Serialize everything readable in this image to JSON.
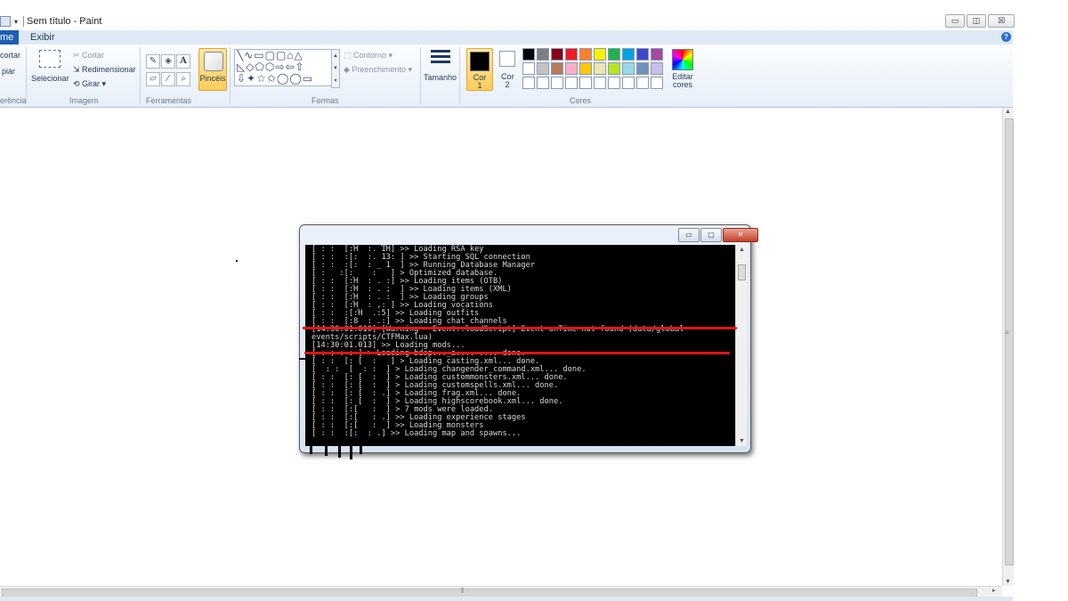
{
  "window": {
    "title": "Sem título - Paint",
    "buttons": {
      "minimize": "▭",
      "maximize": "◫",
      "close": "☒"
    }
  },
  "tabs": {
    "home": "me",
    "view": "Exibir"
  },
  "ribbon": {
    "clipboard": {
      "cut_partial": "cortar",
      "copy_partial": "piar",
      "label_partial": "erência"
    },
    "image": {
      "select": "Selecionar",
      "crop": "Cortar",
      "resize": "Redimensionar",
      "rotate": "Girar ▾",
      "label": "Imagem"
    },
    "tools": {
      "label": "Ferramentas",
      "text_tool": "A"
    },
    "brushes": {
      "label": "Pincéis"
    },
    "shapes": {
      "outline": "Contorno ▾",
      "fill": "Preenchimento ▾",
      "label": "Formas"
    },
    "size": {
      "label": "Tamanho"
    },
    "colors": {
      "color1": "Cor 1",
      "color2": "Cor 2",
      "edit": "Editar cores",
      "label": "Cores"
    }
  },
  "palette": [
    "#000000",
    "#7f7f7f",
    "#880015",
    "#ed1c24",
    "#ff7f27",
    "#fff200",
    "#22b14c",
    "#00a2e8",
    "#3f48cc",
    "#a349a4",
    "#ffffff",
    "#c3c3c3",
    "#b97a57",
    "#ffaec9",
    "#ffc90e",
    "#efe4b0",
    "#b5e61d",
    "#99d9ea",
    "#7092be",
    "#c8bfe7",
    "#ffffff",
    "#ffffff",
    "#ffffff",
    "#ffffff",
    "#ffffff",
    "#ffffff",
    "#ffffff",
    "#ffffff",
    "#ffffff",
    "#ffffff"
  ],
  "console": {
    "lines": [
      "[ : :  [:Ή  :. ΊΉ] >> Loading RSA key",
      "[ : :  :[:  :. 13: ] >> Starting SQL connection",
      "[ : :  :[:  : _ 1  ] >> Running Database Manager",
      "[ :   :[:    :   ] > Optimized database.",
      "[ : :  [:Ή  : . :] >> Loading items (OTB)",
      "[ : :  [:Ή  : . ;  ] >> Loading items (XML)",
      "[ : :  [:Ή  : . :  ] >> Loading groups",
      "[ : :  [:Ή  : ,: ] >> Loading vocations",
      "[ : :  :[:Ή  .:5] >> Loading outfits",
      "[ : :  [:8  : .:] >> Loading chat channels",
      "[14:30:01.010] [Warning - Event::loadScript] Event onTime not found (data/global",
      "events/scripts/CTFMax.lua)",
      "[14:30:01.013] >> Loading mods...",
      "[ : ; : : ] > Loading bdsp..._a.... .... done.",
      "[ : :  [: [  :   ] > Loading casting.xml... done.",
      "[  : :  [  : :  ] > Loading changender_command.xml... done.",
      "[ : :  [: [  :  ] > Loading custommonsters.xml... done.",
      "[ : :  [: [  :  ] > Loading customspells.xml... done.",
      "[ : :  [: [  : .] > Loading frag.xml... done.",
      "[ : :  [: [  :  ] > Loading highscorebook.xml... done.",
      "[ : :  [:[   :  ] > 7 mods were loaded.",
      "[ : :  [:[   : .] >> Loading experience stages",
      "[ : :  [:[   :  ] >> Loading monsters",
      "[ : :  :[:  : .] >> Loading map and spawns..."
    ]
  }
}
